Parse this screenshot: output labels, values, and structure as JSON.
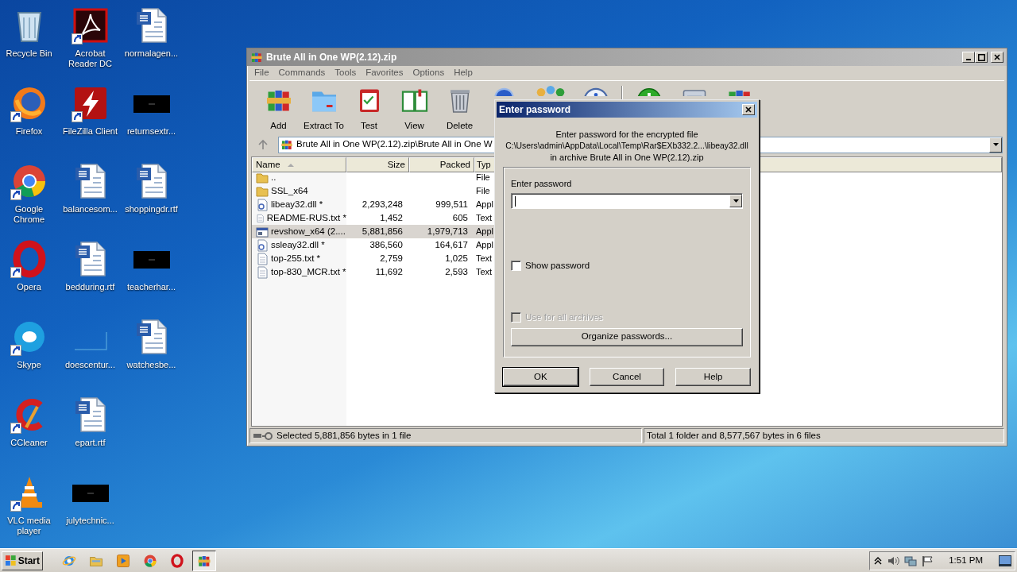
{
  "desktop": {
    "icons": [
      {
        "label": "Recycle Bin",
        "kind": "recycle",
        "shortcut": false
      },
      {
        "label": "Firefox",
        "kind": "firefox",
        "shortcut": true
      },
      {
        "label": "Google Chrome",
        "kind": "chrome",
        "shortcut": true
      },
      {
        "label": "Opera",
        "kind": "opera",
        "shortcut": true
      },
      {
        "label": "Skype",
        "kind": "skype",
        "shortcut": true
      },
      {
        "label": "CCleaner",
        "kind": "ccleaner",
        "shortcut": true
      },
      {
        "label": "VLC media player",
        "kind": "vlc",
        "shortcut": true
      },
      {
        "label": "Acrobat Reader DC",
        "kind": "acrobat",
        "shortcut": true
      },
      {
        "label": "FileZilla Client",
        "kind": "filezilla",
        "shortcut": true
      },
      {
        "label": "balancesom...",
        "kind": "word",
        "shortcut": false
      },
      {
        "label": "bedduring.rtf",
        "kind": "word",
        "shortcut": false
      },
      {
        "label": "doescentur...",
        "kind": "blank",
        "shortcut": false
      },
      {
        "label": "epart.rtf",
        "kind": "word",
        "shortcut": false
      },
      {
        "label": "julytechnic...",
        "kind": "dark",
        "shortcut": false
      },
      {
        "label": "normalagen...",
        "kind": "word",
        "shortcut": false
      },
      {
        "label": "returnsextr...",
        "kind": "dark",
        "shortcut": false
      },
      {
        "label": "shoppingdr.rtf",
        "kind": "word",
        "shortcut": false
      },
      {
        "label": "teacherhar...",
        "kind": "dark",
        "shortcut": false
      },
      {
        "label": "watchesbe...",
        "kind": "word",
        "shortcut": false
      }
    ]
  },
  "window": {
    "title": "Brute All in One WP(2.12).zip",
    "menu": [
      "File",
      "Commands",
      "Tools",
      "Favorites",
      "Options",
      "Help"
    ],
    "toolbar": [
      [
        {
          "label": "Add",
          "kind": "add"
        },
        {
          "label": "Extract To",
          "kind": "extract"
        },
        {
          "label": "Test",
          "kind": "test"
        },
        {
          "label": "View",
          "kind": "view"
        },
        {
          "label": "Delete",
          "kind": "delete"
        },
        {
          "kind": "find"
        },
        {
          "kind": "wizard"
        },
        {
          "kind": "info"
        }
      ],
      [
        {
          "kind": "repair"
        },
        {
          "kind": "comment"
        },
        {
          "kind": "sfx"
        }
      ]
    ],
    "path": "Brute All in One WP(2.12).zip\\Brute All in One W",
    "columns": [
      {
        "label": "Name",
        "sorted": true
      },
      {
        "label": "Size",
        "sorted": false
      },
      {
        "label": "Packed",
        "sorted": false
      },
      {
        "label": "Typ",
        "sorted": false
      }
    ],
    "files": [
      {
        "name": "..",
        "kind": "folder",
        "type": "File",
        "selected": false
      },
      {
        "name": "SSL_x64",
        "kind": "folder",
        "type": "File",
        "selected": false
      },
      {
        "name": "libeay32.dll *",
        "kind": "dll",
        "size": "2,293,248",
        "packed": "999,511",
        "type": "Appl",
        "selected": false
      },
      {
        "name": "README-RUS.txt *",
        "kind": "text",
        "size": "1,452",
        "packed": "605",
        "type": "Text",
        "selected": false
      },
      {
        "name": "revshow_x64 (2....",
        "kind": "exe",
        "size": "5,881,856",
        "packed": "1,979,713",
        "type": "Appl",
        "selected": true
      },
      {
        "name": "ssleay32.dll *",
        "kind": "dll",
        "size": "386,560",
        "packed": "164,617",
        "type": "Appl",
        "selected": false
      },
      {
        "name": "top-255.txt *",
        "kind": "text",
        "size": "2,759",
        "packed": "1,025",
        "type": "Text",
        "selected": false
      },
      {
        "name": "top-830_MCR.txt *",
        "kind": "text",
        "size": "11,692",
        "packed": "2,593",
        "type": "Text",
        "selected": false
      }
    ],
    "status_left": "Selected 5,881,856 bytes in 1 file",
    "status_right": "Total 1 folder and 8,577,567 bytes in 6 files"
  },
  "dialog": {
    "title": "Enter password",
    "message": [
      "Enter password for the encrypted file",
      "C:\\Users\\admin\\AppData\\Local\\Temp\\Rar$EXb332.2...\\libeay32.dll",
      "in archive Brute All in One WP(2.12).zip"
    ],
    "field_label": "Enter password",
    "field_focused": true,
    "show_password": {
      "label": "Show password",
      "checked": false,
      "disabled": false
    },
    "use_all": {
      "label": "Use for all archives",
      "checked": false,
      "disabled": true
    },
    "organize": "Organize passwords...",
    "buttons": [
      {
        "label": "OK",
        "default": true
      },
      {
        "label": "Cancel",
        "default": false
      },
      {
        "label": "Help",
        "default": false
      }
    ]
  },
  "taskbar": {
    "start": "Start",
    "apps": [
      {
        "kind": "ie",
        "selected": false
      },
      {
        "kind": "explorer",
        "selected": false
      },
      {
        "kind": "media",
        "selected": false
      },
      {
        "kind": "chrome",
        "selected": false
      },
      {
        "kind": "opera",
        "selected": false
      },
      {
        "kind": "winrar",
        "selected": true
      }
    ],
    "clock": "1:51 PM"
  }
}
